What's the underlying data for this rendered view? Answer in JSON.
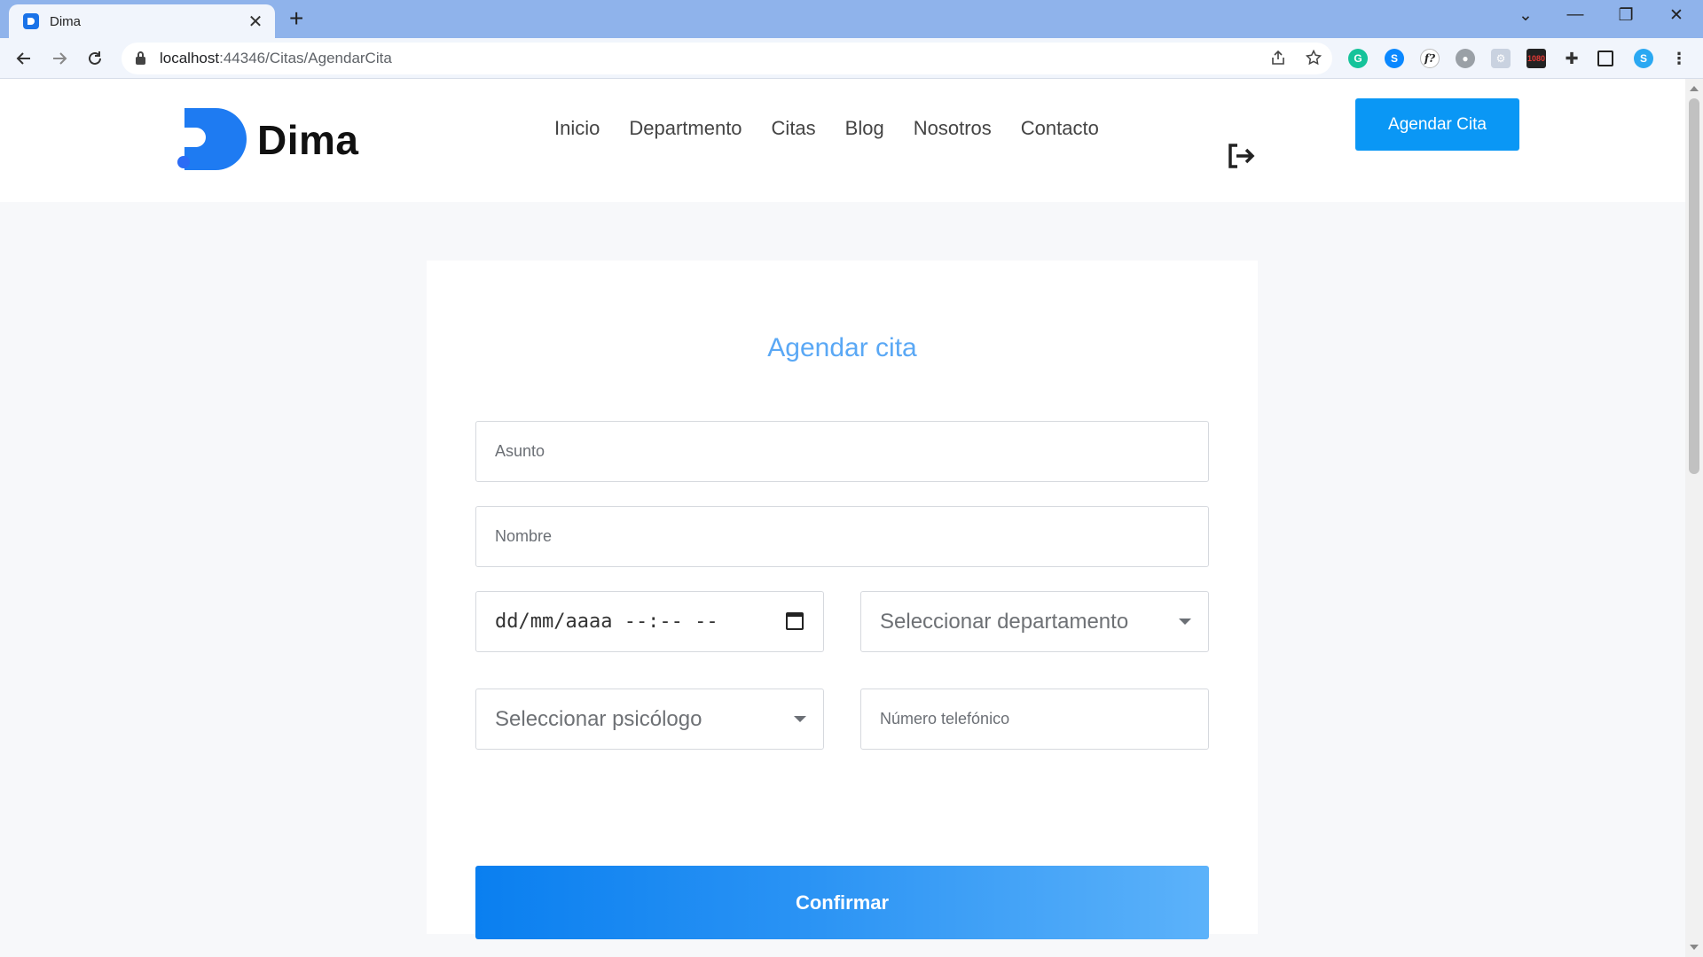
{
  "browser": {
    "tab_title": "Dima",
    "tab_close": "✕",
    "new_tab": "+",
    "url_host": "localhost",
    "url_path": ":44346/Citas/AgendarCita",
    "window_controls": [
      "⌄",
      "—",
      "❐",
      "✕"
    ],
    "nav_icons": [
      "back-icon",
      "forward-icon",
      "reload-icon"
    ],
    "extension_icons": [
      "share-icon",
      "bookmark-star-icon",
      "grammarly-icon",
      "shazam-icon",
      "formula-icon",
      "bug-icon",
      "gear-extension-icon",
      "1080-extension-icon",
      "puzzle-icon",
      "sidebar-icon",
      "profile-icon",
      "menu-icon"
    ]
  },
  "site": {
    "logo_text": "Dima",
    "nav": [
      "Inicio",
      "Departmento",
      "Citas",
      "Blog",
      "Nosotros",
      "Contacto"
    ],
    "cta_label": "Agendar Cita",
    "accent": "#0a97f5"
  },
  "form": {
    "title": "Agendar cita",
    "asunto_placeholder": "Asunto",
    "nombre_placeholder": "Nombre",
    "datetime_value": "dd/mm/aaaa --:-- --",
    "departamento_placeholder": "Seleccionar departamento",
    "psicologo_placeholder": "Seleccionar psicólogo",
    "telefono_placeholder": "Número telefónico",
    "submit_label": "Confirmar",
    "title_color": "#5aa8f5"
  }
}
